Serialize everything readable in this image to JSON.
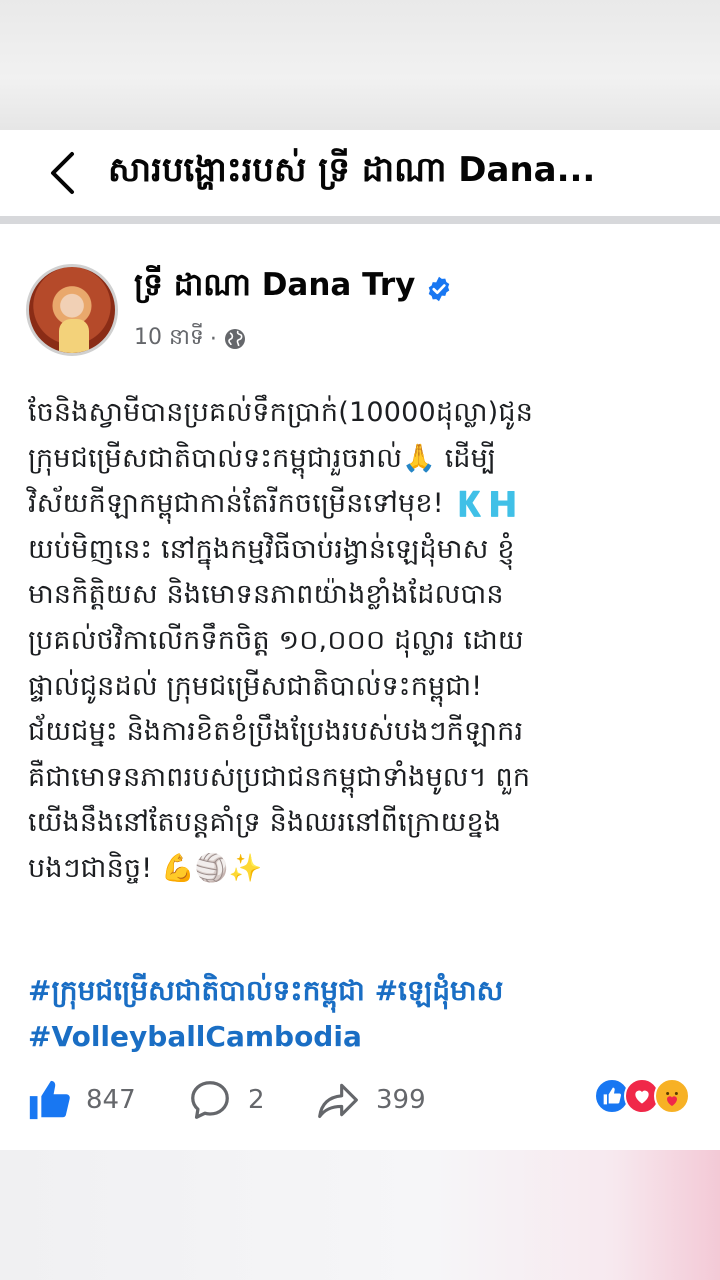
{
  "header": {
    "title": "សារបង្ហោះរបស់ ទ្រី ដាណា Dana..."
  },
  "post": {
    "author": "ទ្រី ដាណា Dana Try",
    "time": "10 នាទី",
    "dot": "·",
    "lines": [
      "ចែនិងស្វាមីបានប្រគល់ទឹកប្រាក់(10000ដុល្លា)ជូន",
      "ក្រុមជម្រើសជាតិបាល់ទះកម្ពុជារួចរាល់🙏 ដើម្បី",
      "វិស័យកីឡាកម្ពុជាកាន់តែរីកចម្រើនទៅមុខ! 🇰🇭",
      "យប់មិញនេះ នៅក្នុងកម្មវិធីចាប់រង្វាន់ឡេដុំមាស ខ្ញុំ",
      "មានកិត្តិយស និងមោទនភាពយ៉ាងខ្លាំងដែលបាន",
      "ប្រគល់ថវិកាលើកទឹកចិត្ត ១០,០០០ ដុល្លារ ដោយ",
      "ផ្ទាល់ជូនដល់ ក្រុមជម្រើសជាតិបាល់ទះកម្ពុជា!",
      "ជ័យជម្នះ និងការខិតខំប្រឹងប្រែងរបស់បងៗកីឡាករ",
      "គឺជាមោទនភាពរបស់ប្រជាជនកម្ពុជាទាំងមូល។ ពួក",
      "យើងនឹងនៅតែបន្តគាំទ្រ និងឈរនៅពីក្រោយខ្នង",
      "បងៗជានិច្ច! 💪🏐✨"
    ],
    "hashtags": [
      "#ក្រុមជម្រើសជាតិបាល់ទះកម្ពុជា",
      "#ឡេដុំមាស",
      "#VolleyballCambodia"
    ]
  },
  "stats": {
    "likes": "847",
    "comments": "2",
    "shares": "399"
  },
  "colors": {
    "link": "#1a6ec4",
    "like": "#1877f2",
    "love": "#f02849"
  },
  "icons": [
    "back-arrow-icon",
    "verified-badge-icon",
    "globe-icon",
    "like-icon",
    "comment-icon",
    "share-icon",
    "like-reaction-icon",
    "love-reaction-icon",
    "care-reaction-icon"
  ]
}
